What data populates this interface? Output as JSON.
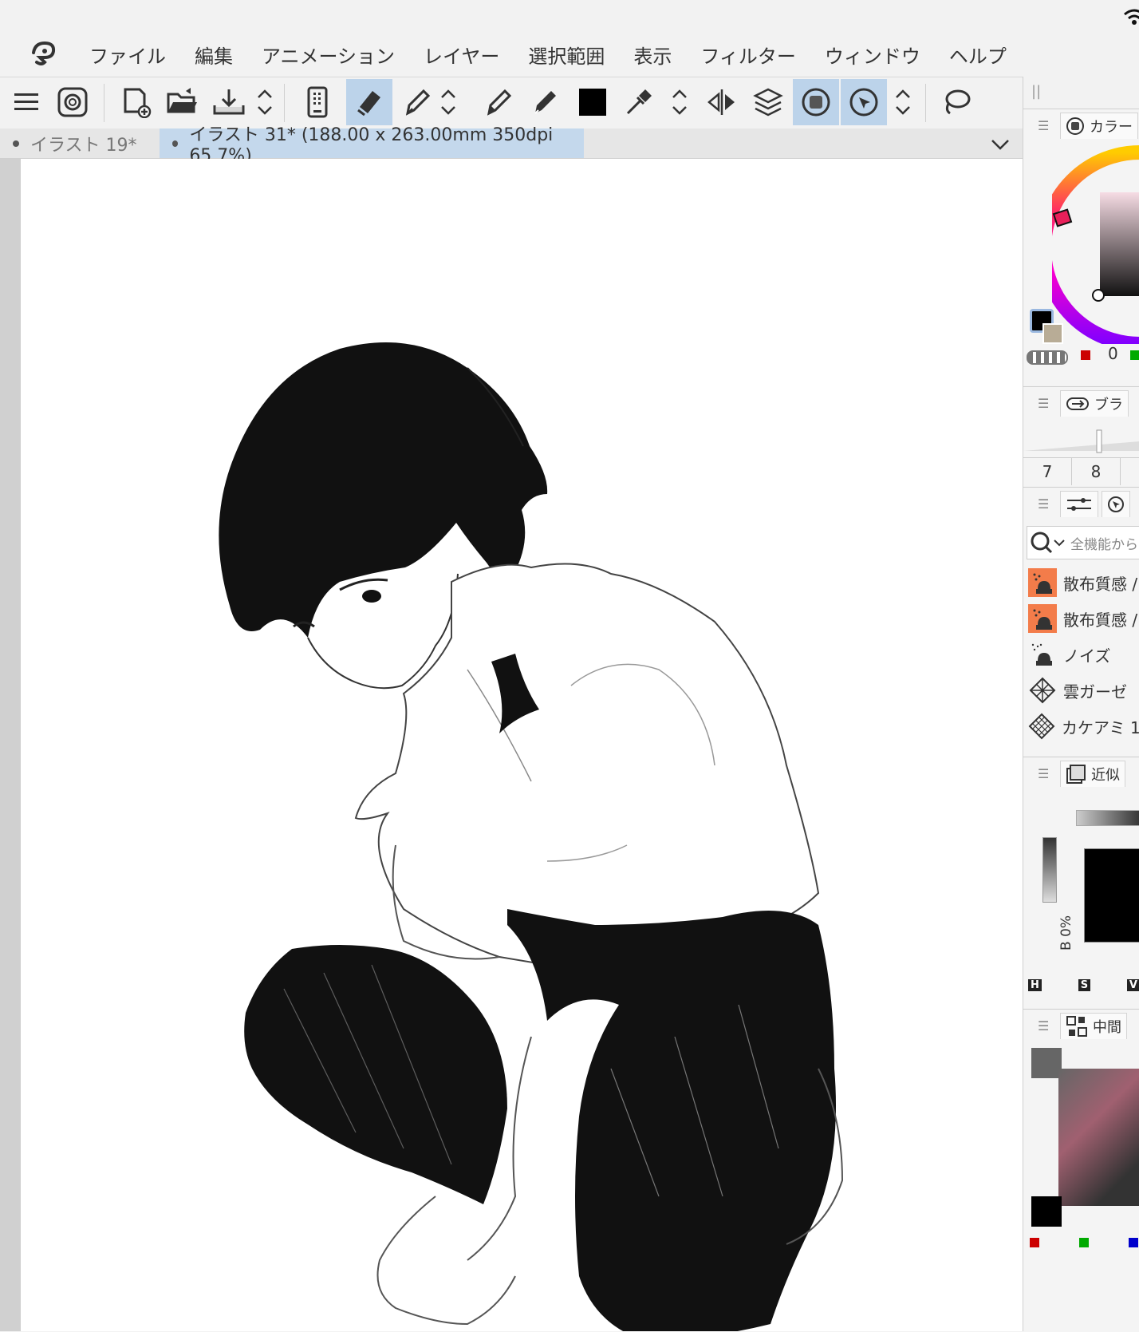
{
  "menu": {
    "items": [
      "ファイル",
      "編集",
      "アニメーション",
      "レイヤー",
      "選択範囲",
      "表示",
      "フィルター",
      "ウィンドウ",
      "ヘルプ"
    ]
  },
  "tabs": [
    {
      "label": "イラスト 19*",
      "active": false
    },
    {
      "label": "イラスト 31* (188.00 x 263.00mm 350dpi 65.7%)",
      "active": true
    }
  ],
  "toolbar": {
    "active_color": "#000000"
  },
  "panels": {
    "color": {
      "tab_label": "カラー",
      "value_readout": "0"
    },
    "brush_size": {
      "tab_label": "ブラ",
      "sizes": [
        "7",
        "8"
      ]
    },
    "sub_tool": {
      "search_placeholder": "全機能から",
      "items": [
        {
          "label": "散布質感 /",
          "icon": "spray-texture-icon"
        },
        {
          "label": "散布質感 /",
          "icon": "spray-texture-icon"
        },
        {
          "label": "ノイズ",
          "icon": "noise-icon"
        },
        {
          "label": "雲ガーゼ",
          "icon": "gauze-icon"
        },
        {
          "label": "カケアミ 1",
          "icon": "crosshatch-icon"
        }
      ]
    },
    "approx_color": {
      "tab_label": "近似",
      "b_label": "B 0%",
      "hsv": [
        "H",
        "S",
        "V"
      ]
    },
    "intermediate_color": {
      "tab_label": "中間"
    }
  },
  "colors": {
    "accent": "#bcd3ea",
    "tab_active": "#c4d8ec",
    "hue_marker": "#e8205a",
    "secondary_swatch": "#b8ac96",
    "gray_swatch": "#666666"
  }
}
